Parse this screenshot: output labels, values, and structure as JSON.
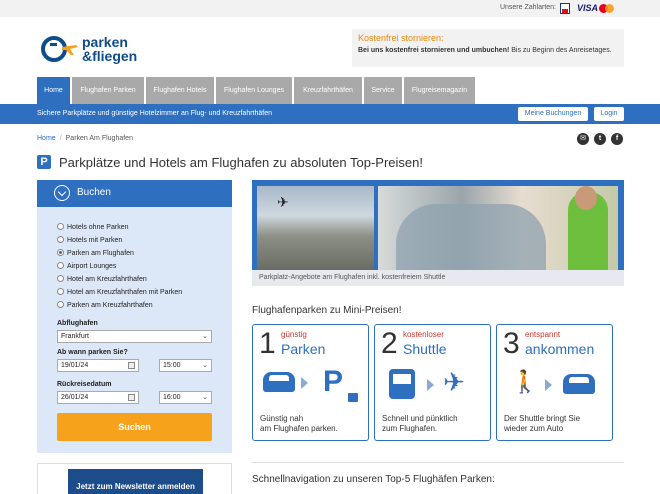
{
  "payment": {
    "label": "Unsere Zahlarten:",
    "visa": "VISA"
  },
  "logo": {
    "line1": "parken",
    "line2": "&fliegen"
  },
  "notice": {
    "title": "Kostenfrei stornieren:",
    "bold": "Bei uns kostenfrei stornieren und umbuchen!",
    "rest": " Bis zu Beginn des Anreisetages."
  },
  "tabs": [
    {
      "label": "Home"
    },
    {
      "label": "Flughafen Parken"
    },
    {
      "label": "Flughafen Hotels"
    },
    {
      "label": "Flughafen Lounges"
    },
    {
      "label": "Kreuzfahrthäfen"
    },
    {
      "label": "Service"
    },
    {
      "label": "Flugreisemagazin"
    }
  ],
  "bluebar": {
    "slogan": "Sichere Parkplätze und günstige Hotelzimmer an Flug- und Kreuzfahrthäfen",
    "bookings_button": "Meine Buchungen",
    "login_button": "Login"
  },
  "breadcrumb": {
    "home": "Home",
    "sep": "/",
    "current": "Parken Am Flughafen"
  },
  "social": {
    "email": "✉",
    "twitter": "t",
    "facebook": "f"
  },
  "page": {
    "badge": "P",
    "title": "Parkplätze und Hotels am Flughafen zu absoluten Top-Preisen!"
  },
  "booking": {
    "header": "Buchen",
    "options": [
      {
        "label": "Hotels ohne Parken",
        "selected": false
      },
      {
        "label": "Hotels mit Parken",
        "selected": false
      },
      {
        "label": "Parken am Flughafen",
        "selected": true
      },
      {
        "label": "Airport Lounges",
        "selected": false
      },
      {
        "label": "Hotel am Kreuzfahrthafen",
        "selected": false
      },
      {
        "label": "Hotel am Kreuzfahrthafen mit Parken",
        "selected": false
      },
      {
        "label": "Parken am Kreuzfahrthafen",
        "selected": false
      }
    ],
    "airport_label": "Abflughafen",
    "airport_value": "Frankfurt",
    "from_label": "Ab wann parken Sie?",
    "from_date": "19/01/24",
    "from_time": "15:00",
    "return_label": "Rückreisedatum",
    "return_date": "26/01/24",
    "return_time": "16:00",
    "search_button": "Suchen"
  },
  "newsletter": {
    "label": "Jetzt zum Newsletter anmelden"
  },
  "hero": {
    "caption": "Parkplatz-Angebote am Flughafen inkl. kostenfreiem Shuttle"
  },
  "steps_title": "Flughafenparken zu Mini-Preisen!",
  "steps": [
    {
      "num": "1",
      "small": "günstig",
      "big": "Parken",
      "desc1": "Günstig nah",
      "desc2": "am Flughafen parken."
    },
    {
      "num": "2",
      "small": "kostenloser",
      "big": "Shuttle",
      "desc1": "Schnell und pünktlich",
      "desc2": "zum Flughafen."
    },
    {
      "num": "3",
      "small": "entspannt",
      "big": "ankommen",
      "desc1": "Der Shuttle bringt Sie",
      "desc2": "wieder zum Auto"
    }
  ],
  "quicknav_title": "Schnellnavigation zu unseren Top-5 Flughäfen Parken:",
  "colors": {
    "primary": "#2f6fbf",
    "accent": "#f7a21b",
    "notice": "#e8890c",
    "highlight": "#d0342c"
  }
}
